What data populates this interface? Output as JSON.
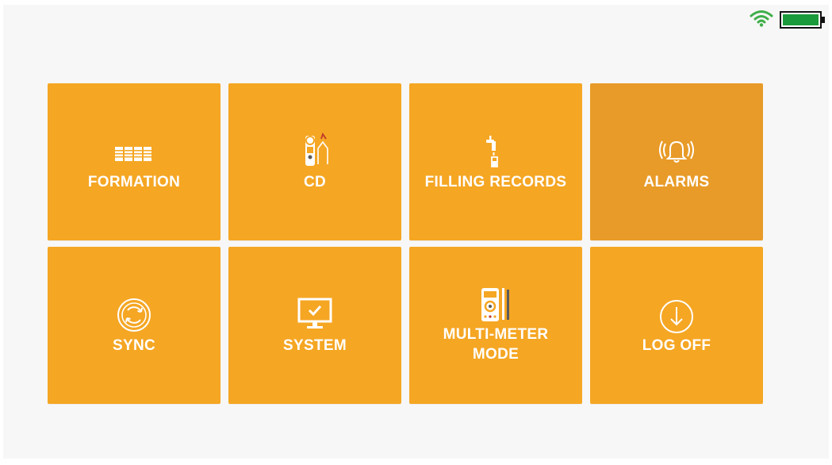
{
  "status": {
    "wifi_icon": "wifi-icon",
    "battery_icon": "battery-icon",
    "wifi_color": "#3fae49",
    "battery_color": "#1a9a3a"
  },
  "colors": {
    "tile": "#f5a623",
    "tile_active": "#e89b28",
    "text": "#ffffff",
    "background": "#f7f7f7"
  },
  "menu": {
    "tiles": [
      {
        "label": "FORMATION",
        "icon": "formation-bars-icon"
      },
      {
        "label": "CD",
        "icon": "clamp-meter-icon"
      },
      {
        "label": "FILLING RECORDS",
        "icon": "water-tap-icon"
      },
      {
        "label": "ALARMS",
        "icon": "alarm-bell-icon",
        "selected": true
      },
      {
        "label": "SYNC",
        "icon": "sync-icon"
      },
      {
        "label": "SYSTEM",
        "icon": "monitor-check-icon"
      },
      {
        "label": "MULTI-METER\nMODE",
        "icon": "multimeter-icon"
      },
      {
        "label": "LOG OFF",
        "icon": "log-off-icon"
      }
    ]
  }
}
